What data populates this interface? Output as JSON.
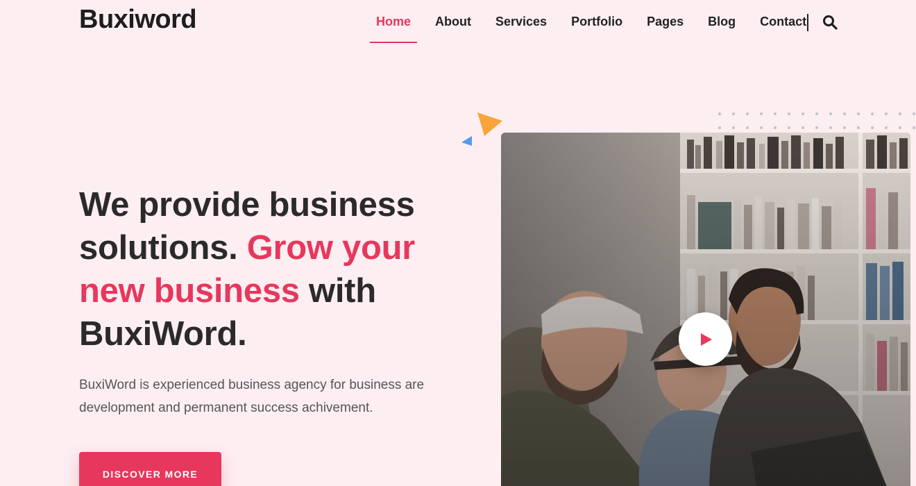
{
  "brand": {
    "logo_text": "Buxiword",
    "accent_color": "#e8375c"
  },
  "nav": {
    "items": [
      {
        "label": "Home",
        "active": true
      },
      {
        "label": "About",
        "active": false
      },
      {
        "label": "Services",
        "active": false
      },
      {
        "label": "Portfolio",
        "active": false
      },
      {
        "label": "Pages",
        "active": false
      },
      {
        "label": "Blog",
        "active": false
      },
      {
        "label": "Contact",
        "active": false
      }
    ],
    "search_icon": "search-icon"
  },
  "hero": {
    "headline_part1": "We provide business solutions. ",
    "headline_accent": "Grow your new business",
    "headline_part2": " with BuxiWord.",
    "description": "BuxiWord is experienced business agency for business are development and permanent success achivement.",
    "cta_label": "DISCOVER MORE",
    "play_icon": "play-icon"
  },
  "colors": {
    "background": "#fdeef2",
    "text": "#2a2a2a",
    "orange": "#f9a43a",
    "blue": "#4e9bf0"
  }
}
